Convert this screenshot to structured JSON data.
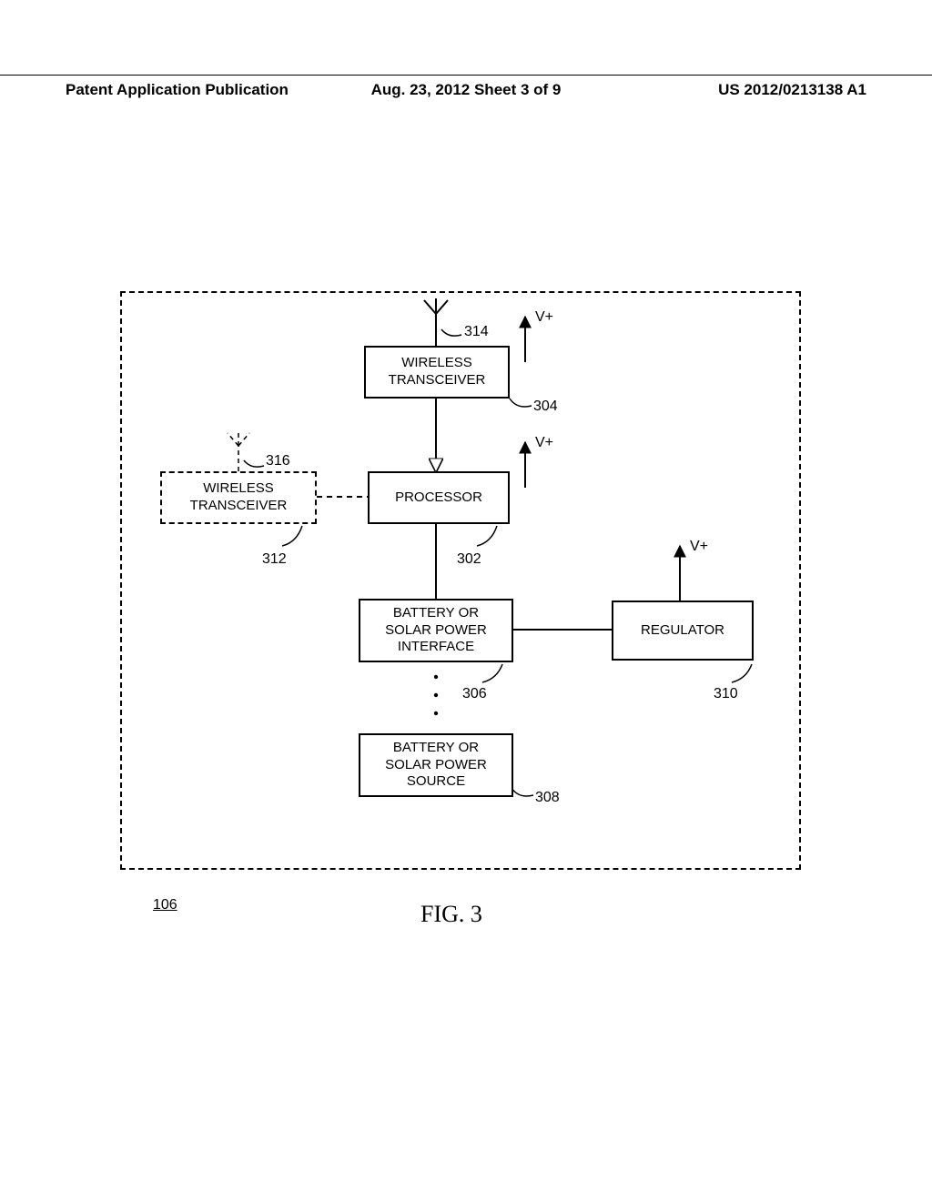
{
  "header": {
    "left": "Patent Application Publication",
    "mid": "Aug. 23, 2012  Sheet 3 of 9",
    "right": "US 2012/0213138 A1"
  },
  "blocks": {
    "xcvr1": "WIRELESS\nTRANSCEIVER",
    "xcvr2": "WIRELESS\nTRANSCEIVER",
    "proc": "PROCESSOR",
    "pif": "BATTERY OR\nSOLAR POWER\nINTERFACE",
    "psrc": "BATTERY OR\nSOLAR POWER\nSOURCE",
    "reg": "REGULATOR"
  },
  "refs": {
    "r314": "314",
    "r304": "304",
    "r316": "316",
    "r312": "312",
    "r302": "302",
    "r306": "306",
    "r310": "310",
    "r308": "308",
    "r106": "106"
  },
  "labels": {
    "vplus": "V+",
    "fig": "FIG.  3"
  }
}
